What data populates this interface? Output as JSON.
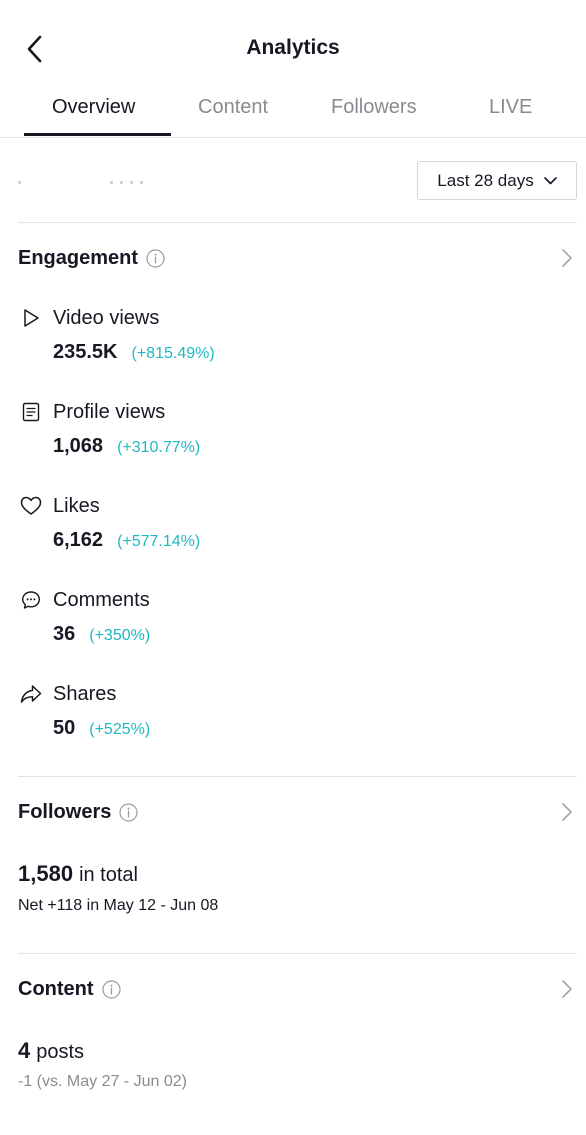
{
  "header": {
    "title": "Analytics",
    "back_icon": "chevron-left-icon"
  },
  "tabs": [
    {
      "label": "Overview",
      "active": true
    },
    {
      "label": "Content",
      "active": false
    },
    {
      "label": "Followers",
      "active": false
    },
    {
      "label": "LIVE",
      "active": false
    }
  ],
  "date_filter": {
    "label": "Last 28 days",
    "icon": "chevron-down-icon"
  },
  "engagement": {
    "title": "Engagement",
    "metrics": [
      {
        "label": "Video views",
        "value": "235.5K",
        "change": "(+815.49%)",
        "icon": "play-icon"
      },
      {
        "label": "Profile views",
        "value": "1,068",
        "change": "(+310.77%)",
        "icon": "profile-document-icon"
      },
      {
        "label": "Likes",
        "value": "6,162",
        "change": "(+577.14%)",
        "icon": "heart-icon"
      },
      {
        "label": "Comments",
        "value": "36",
        "change": "(+350%)",
        "icon": "comment-icon"
      },
      {
        "label": "Shares",
        "value": "50",
        "change": "(+525%)",
        "icon": "share-icon"
      }
    ]
  },
  "followers": {
    "title": "Followers",
    "total": "1,580",
    "total_suffix": "in total",
    "net": "Net +118 in May 12 - Jun 08"
  },
  "content": {
    "title": "Content",
    "count": "4",
    "count_suffix": "posts",
    "comparison": "-1 (vs. May 27 - Jun 02)"
  },
  "colors": {
    "positive_change": "#20b8c0",
    "text": "#161823",
    "muted": "#8a8b91"
  }
}
